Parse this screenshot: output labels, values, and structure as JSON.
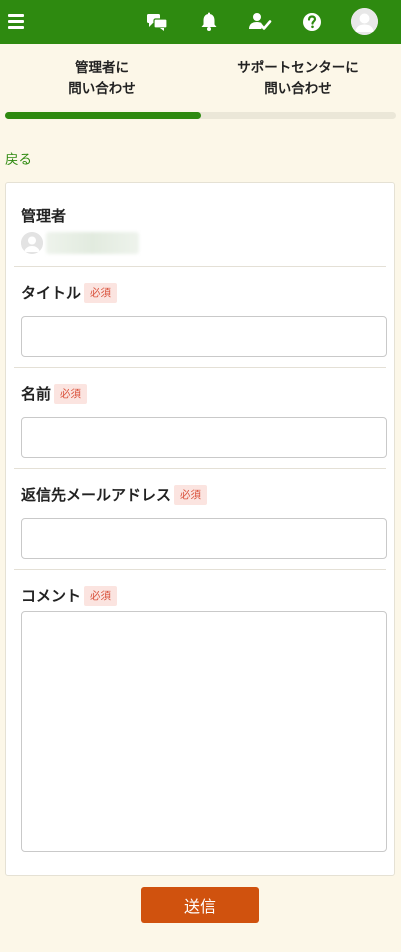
{
  "header": {
    "icons": [
      "menu-icon",
      "chat-icon",
      "bell-icon",
      "user-check-icon",
      "help-icon",
      "user-avatar-icon"
    ],
    "brand_color": "#2e8a10"
  },
  "tabs": {
    "admin": {
      "line1": "管理者に",
      "line2": "問い合わせ"
    },
    "support": {
      "line1": "サポートセンターに",
      "line2": "問い合わせ"
    },
    "progress_fraction": 0.5
  },
  "back_label": "戻る",
  "form": {
    "admin_label": "管理者",
    "title_label": "タイトル",
    "name_label": "名前",
    "email_label": "返信先メールアドレス",
    "comment_label": "コメント",
    "required_badge": "必須",
    "title_value": "",
    "name_value": "",
    "email_value": "",
    "comment_value": ""
  },
  "submit_label": "送信",
  "colors": {
    "accent": "#2e8a10",
    "submit": "#d0520e",
    "required_bg": "#fbe4e0",
    "required_text": "#d9523c"
  }
}
